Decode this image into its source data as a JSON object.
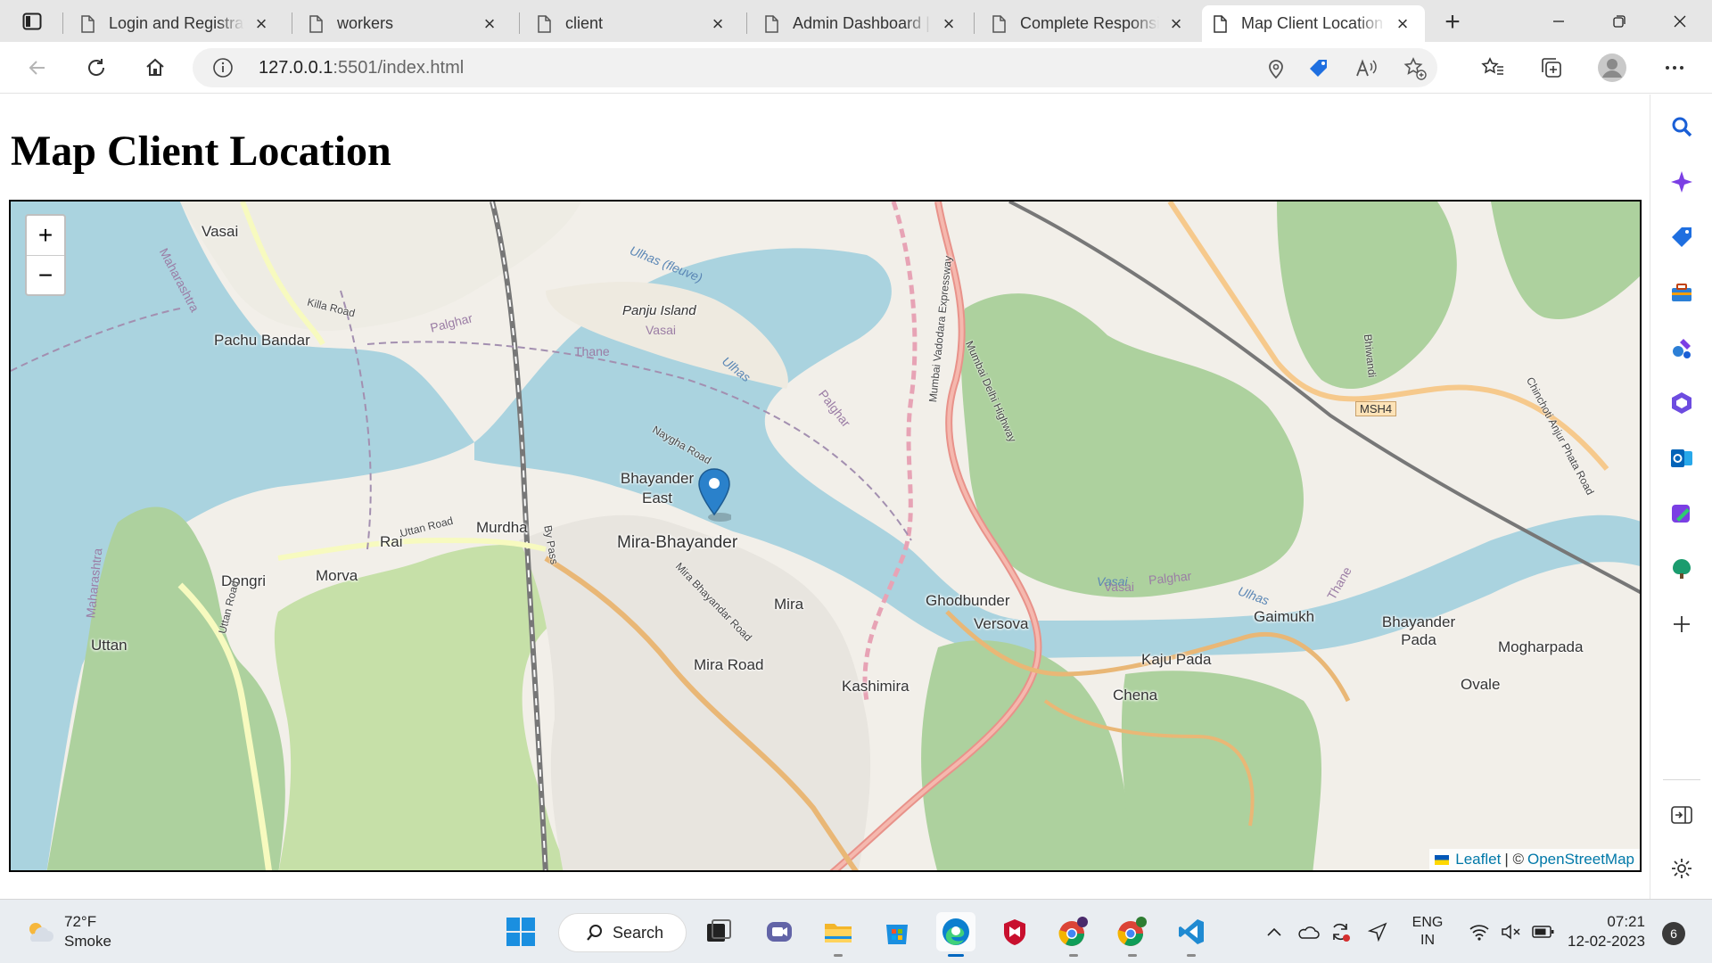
{
  "browser": {
    "tabs": [
      {
        "title": "Login and Registrati",
        "active": false
      },
      {
        "title": "workers",
        "active": false
      },
      {
        "title": "client",
        "active": false
      },
      {
        "title": "Admin Dashboard |",
        "active": false
      },
      {
        "title": "Complete Responsi",
        "active": false
      },
      {
        "title": "Map Client Location",
        "active": true
      }
    ],
    "address": {
      "host": "127.0.0.1",
      "rest": ":5501/index.html"
    }
  },
  "page": {
    "title": "Map Client Location",
    "map": {
      "zoom_in": "+",
      "zoom_out": "−",
      "attribution": {
        "leaflet": "Leaflet",
        "separator": "| ©",
        "osm": "OpenStreetMap"
      },
      "places": [
        "Vasai",
        "Pachu Bandar",
        "Panju Island",
        "Bhayander East",
        "Mira-Bhayander",
        "Murdha",
        "Rai",
        "Morva",
        "Dongri",
        "Uttan",
        "Mira",
        "Mira Road",
        "Kashimira",
        "Ghodbunder",
        "Versova",
        "Gaimukh",
        "Bhayander Pada",
        "Mogharpada",
        "Ovale",
        "Kaju Pada",
        "Chena"
      ],
      "water_labels": [
        "Ulhas (fleuve)",
        "Ulhas",
        "Vasai",
        "Ulhas"
      ],
      "admin_labels": [
        "Maharashtra",
        "Palghar",
        "Vasai",
        "Thane",
        "Palghar",
        "Vasai",
        "Palghar",
        "Thane",
        "Maharashtra"
      ],
      "road_labels": [
        "Killa Road",
        "Naygha Road",
        "Uttan Road",
        "Mira Bhayandar Road",
        "Mumbai Vadodara Expressway",
        "Mumbai Delhi Highway",
        "Bhiwandi",
        "Chinchoti Anjur Phata Road",
        "Uttan Road",
        "By Pass"
      ],
      "shield": "MSH4"
    }
  },
  "taskbar": {
    "weather": {
      "temp": "72°F",
      "condition": "Smoke"
    },
    "search_label": "Search",
    "lang": {
      "line1": "ENG",
      "line2": "IN"
    },
    "clock": {
      "time": "07:21",
      "date": "12-02-2023"
    },
    "notifications": "6"
  }
}
